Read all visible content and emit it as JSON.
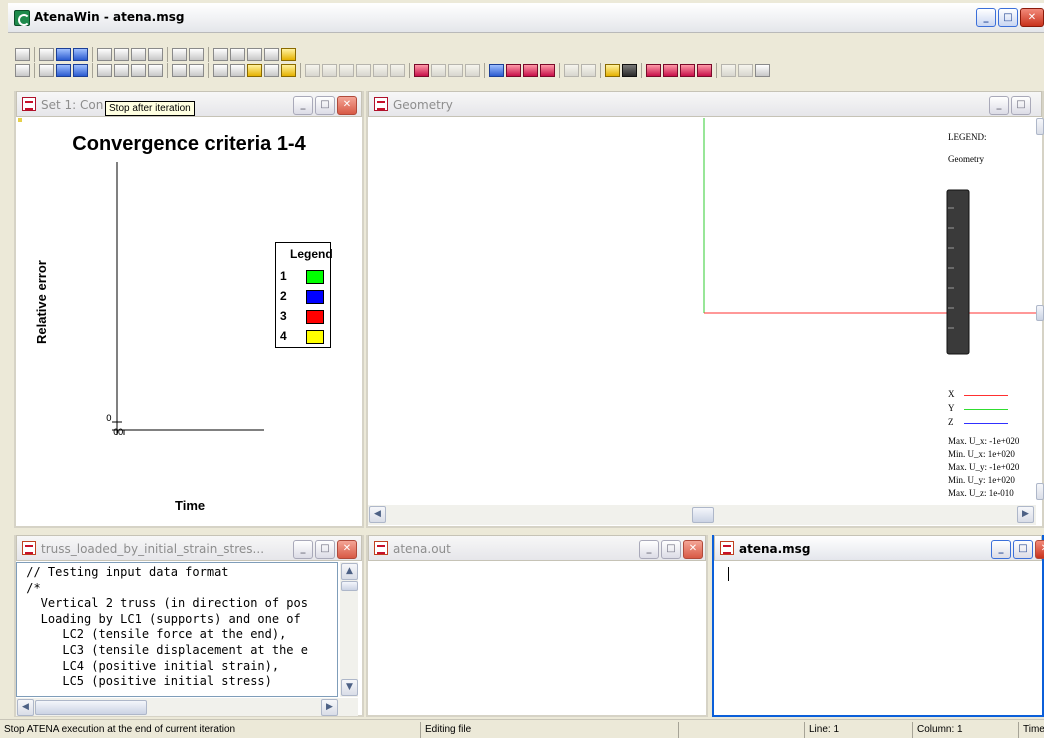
{
  "app": {
    "title": "AtenaWin - atena.msg",
    "accent": "#0b5fd9"
  },
  "toolbar_rows": {
    "row1_icons": [
      "run-icon",
      "save-data-icon",
      "save-all-icon",
      "refresh-icon",
      "open-mesh-icon",
      "mesh-icon",
      "mesh-icon",
      "mesh-icon",
      "tree-icon",
      "log-icon",
      "grid-icon",
      "grid-icon",
      "grid-icon",
      "grid-icon",
      "export-icon"
    ],
    "row2_icons": [
      "run-icon",
      "save-data-icon",
      "save-all-icon",
      "refresh-icon",
      "open-mesh-icon",
      "mesh-icon",
      "mesh-icon",
      "mesh-icon",
      "tree-icon",
      "log-icon",
      "grid-icon",
      "grid-icon",
      "info-icon",
      "grid-icon",
      "export-icon",
      "zoom-icon",
      "rotate-icon",
      "grid-view-icon",
      "render-icon",
      "solid-icon",
      "pan-icon",
      "axes-icon",
      "trim-icon",
      "zoom-window-icon",
      "zoom-fit-icon",
      "undo-view-icon",
      "node-icon",
      "node-add-icon",
      "mesh-grid-icon",
      "settings-icon",
      "properties-icon",
      "open-folder-icon",
      "save-icon",
      "load-case-1-icon",
      "load-case-2-icon",
      "load-case-3-icon",
      "load-case-4-icon",
      "cut-icon",
      "copy-icon",
      "paste-icon"
    ]
  },
  "tooltip": "Stop after iteration",
  "windows": {
    "convergence": {
      "title": "Set 1: Convergence criteria 1-4",
      "title_visible": "Set 1: Con",
      "chart_data": {
        "type": "line",
        "title": "Convergence criteria 1-4",
        "xlabel": "Time",
        "ylabel": "Relative error",
        "y_tick_labels": [
          "0"
        ],
        "x_tick_labels": [
          "0",
          "0"
        ],
        "legend_title": "Legend",
        "legend_position": "right",
        "series": [
          {
            "name": "1",
            "color": "#00ff00",
            "values": []
          },
          {
            "name": "2",
            "color": "#0000ff",
            "values": []
          },
          {
            "name": "3",
            "color": "#ff0000",
            "values": []
          },
          {
            "name": "4",
            "color": "#ffff00",
            "values": []
          }
        ]
      }
    },
    "geometry": {
      "title": "Geometry",
      "legend_title": "LEGEND:",
      "legend_subtitle": "Geometry",
      "axes": [
        {
          "label": "X",
          "color": "#ff3030"
        },
        {
          "label": "Y",
          "color": "#30dd30"
        },
        {
          "label": "Z",
          "color": "#3030ff"
        }
      ],
      "stats": [
        {
          "label": "Max. U_x:",
          "value": "-1e+020"
        },
        {
          "label": "Min. U_x:",
          "value": "1e+020"
        },
        {
          "label": "Max. U_y:",
          "value": "-1e+020"
        },
        {
          "label": "Min. U_y:",
          "value": "1e+020"
        },
        {
          "label": "Max. U_z:",
          "value": "1e-010"
        }
      ]
    },
    "truss": {
      "title": "truss_loaded_by_initial_strain_stres...",
      "lines": [
        " // Testing input data format",
        " /*",
        "   Vertical 2 truss (in direction of pos",
        "   Loading by LC1 (supports) and one of",
        "      LC2 (tensile force at the end),",
        "      LC3 (tensile displacement at the e",
        "      LC4 (positive initial strain),",
        "      LC5 (positive initial stress)"
      ]
    },
    "atena_out": {
      "title": "atena.out"
    },
    "atena_msg": {
      "title": "atena.msg"
    }
  },
  "statusbar": {
    "message": "Stop ATENA execution at the end of current iteration",
    "mode": "Editing file",
    "line": "Line: 1",
    "column": "Column: 1",
    "time": "Time"
  }
}
